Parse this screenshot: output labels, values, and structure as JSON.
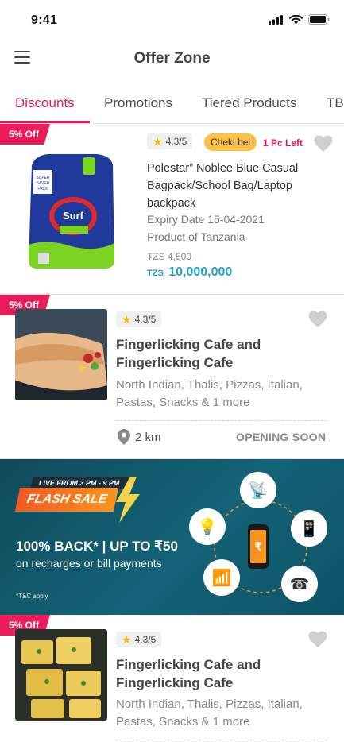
{
  "status": {
    "time": "9:41"
  },
  "app": {
    "title": "Offer Zone"
  },
  "tabs": [
    {
      "label": "Discounts",
      "active": true
    },
    {
      "label": "Promotions",
      "active": false
    },
    {
      "label": "Tiered Products",
      "active": false
    },
    {
      "label": "TB",
      "active": false
    }
  ],
  "products": [
    {
      "badge": "5% Off",
      "rating": "4.3/5",
      "chip": "Cheki bei",
      "stock_note": "1 Pc Left",
      "title_lines": [
        "Polestar” Noblee Blue Casual",
        "Bagpack/School Bag/Laptop",
        "backpack"
      ],
      "expiry": "Expiry Date 15-04-2021",
      "origin": "Product of Tanzania",
      "old_price": "TZS 4,500",
      "currency": "TZS",
      "new_price": "10,000,000",
      "image_label": "Surf excel MATIC"
    }
  ],
  "cafes": [
    {
      "badge": "5% Off",
      "rating": "4.3/5",
      "title_lines": [
        "Fingerlicking Cafe and",
        "Fingerlicking Cafe"
      ],
      "cuisine_lines": [
        "North Indian, Thalis, Pizzas, Italian,",
        "Pastas, Snacks & 1 more"
      ],
      "distance": "2 km",
      "status": "OPENING SOON"
    },
    {
      "badge": "5% Off",
      "rating": "4.3/5",
      "title_lines": [
        "Fingerlicking Cafe and",
        "Fingerlicking Cafe"
      ],
      "cuisine_lines": [
        "North Indian, Thalis, Pizzas, Italian,",
        "Pastas, Snacks & 1 more"
      ]
    }
  ],
  "banner": {
    "live": "LIVE FROM 3 PM - 9 PM",
    "flash": "FLASH SALE",
    "headline": "100% BACK* | UP TO ₹50",
    "subline": "on recharges or bill payments",
    "terms": "*T&C apply"
  },
  "colors": {
    "accent": "#e8165d",
    "price": "#23a3c9",
    "chip": "#fdc146"
  }
}
